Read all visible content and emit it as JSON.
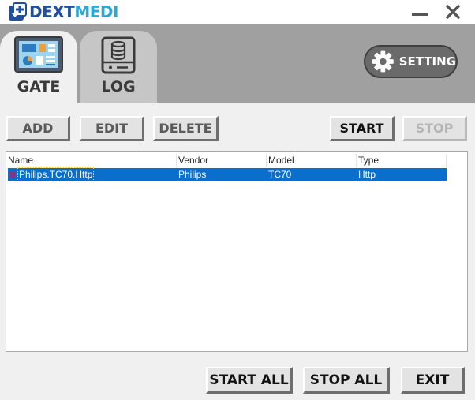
{
  "app": {
    "brand_part1": "DEXT",
    "brand_part2": "MEDI",
    "colors": {
      "brand_dark": "#1f4fa0",
      "brand_light": "#2aa8d8",
      "header_bg": "#a0a0a0",
      "selection": "#0a6ecc"
    }
  },
  "window": {
    "minimize_icon": "minimize-icon",
    "close_icon": "close-icon"
  },
  "tabs": [
    {
      "label": "GATE",
      "icon": "dashboard-icon",
      "active": true
    },
    {
      "label": "LOG",
      "icon": "database-icon",
      "active": false
    }
  ],
  "setting": {
    "label": "SETTING",
    "icon": "gear-icon"
  },
  "toolbar": {
    "add_label": "ADD",
    "edit_label": "EDIT",
    "delete_label": "DELETE",
    "start_label": "START",
    "stop_label": "STOP"
  },
  "list": {
    "columns": [
      "Name",
      "Vendor",
      "Model",
      "Type"
    ],
    "rows": [
      {
        "name": "Philips.TC70.Http",
        "vendor": "Philips",
        "model": "TC70",
        "type": "Http"
      }
    ]
  },
  "footer": {
    "start_all_label": "START ALL",
    "stop_all_label": "STOP ALL",
    "exit_label": "EXIT"
  }
}
